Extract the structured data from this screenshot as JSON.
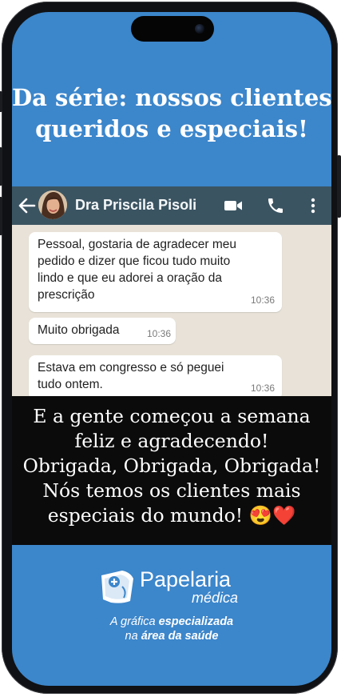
{
  "headline": {
    "line1": "Da série: nossos clientes",
    "line2": "queridos e especiais!"
  },
  "chat": {
    "contact_name": "Dra Priscila Pisoli",
    "messages": [
      {
        "lines": [
          "Pessoal, gostaria de agradecer meu",
          "pedido e dizer que ficou tudo muito",
          "lindo e que eu adorei a oração da",
          "prescrição"
        ],
        "time": "10:36"
      },
      {
        "lines": [
          "Muito obrigada"
        ],
        "time": "10:36"
      },
      {
        "lines": [
          "Estava em congresso e só peguei",
          "tudo ontem."
        ],
        "time": "10:36"
      }
    ]
  },
  "caption": {
    "lines": [
      "E a gente começou a semana",
      "feliz e  agradecendo!",
      "Obrigada, Obrigada, Obrigada!",
      "Nós temos os clientes mais",
      "especiais do mundo! 😍❤️"
    ]
  },
  "brand": {
    "name": "Papelaria",
    "sub": "médica",
    "tagline_prefix": "A gráfica ",
    "tagline_bold": "especializada",
    "tagline2_prefix": "na ",
    "tagline2_bold": "área da saúde"
  },
  "colors": {
    "screen_blue": "#3c86cb",
    "chat_header": "#3b5462",
    "chat_bg": "#e8e2d8",
    "band": "#0b0b0b"
  },
  "icons": [
    "back-arrow-icon",
    "video-call-icon",
    "phone-call-icon",
    "more-vertical-icon",
    "brand-logo-icon"
  ]
}
